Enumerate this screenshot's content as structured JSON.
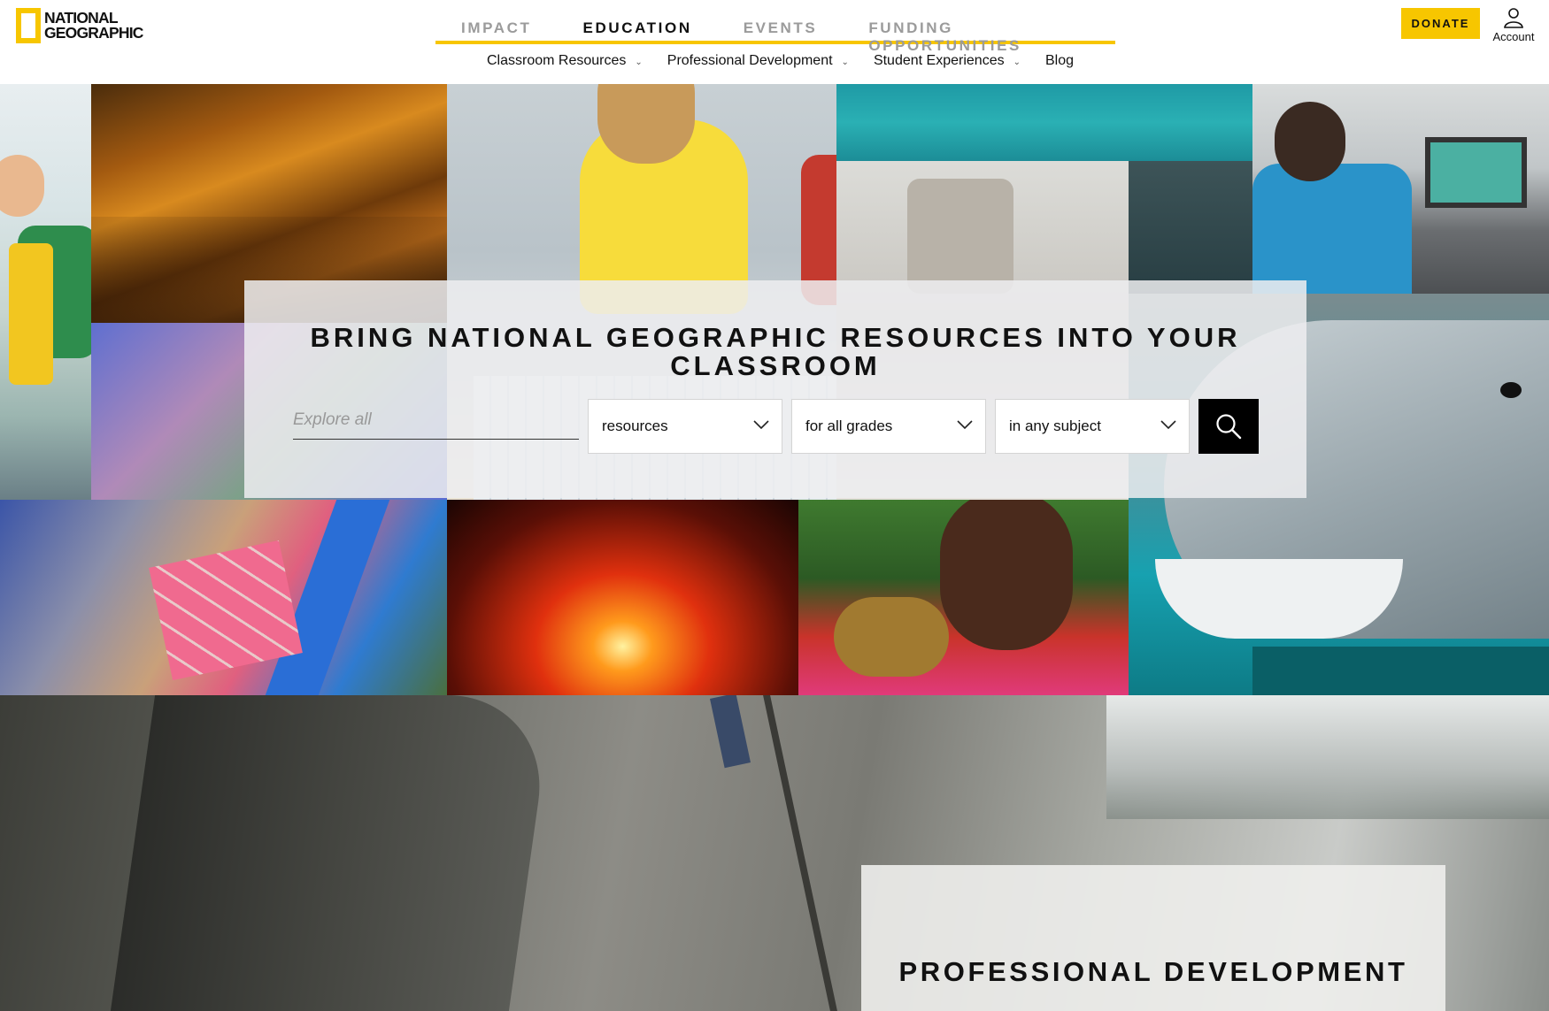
{
  "brand": {
    "logo_line1": "NATIONAL",
    "logo_line2": "GEOGRAPHIC",
    "accent_color": "#f7c600"
  },
  "primary_nav": {
    "items": [
      {
        "label": "IMPACT",
        "active": false
      },
      {
        "label": "EDUCATION",
        "active": true
      },
      {
        "label": "EVENTS",
        "active": false
      },
      {
        "label": "FUNDING OPPORTUNITIES",
        "active": false
      }
    ]
  },
  "sub_nav": {
    "items": [
      {
        "label": "Classroom Resources",
        "has_dropdown": true
      },
      {
        "label": "Professional Development",
        "has_dropdown": true
      },
      {
        "label": "Student Experiences",
        "has_dropdown": true
      },
      {
        "label": "Blog",
        "has_dropdown": false
      }
    ]
  },
  "header_actions": {
    "donate_label": "DONATE",
    "account_label": "Account",
    "account_icon": "user-icon"
  },
  "search": {
    "title": "BRING NATIONAL GEOGRAPHIC RESOURCES INTO YOUR CLASSROOM",
    "placeholder": "Explore all",
    "resource_select": "resources",
    "grade_select": "for all grades",
    "subject_select": "in any subject",
    "button_icon": "search-icon"
  },
  "professional_development": {
    "title": "PROFESSIONAL DEVELOPMENT"
  }
}
